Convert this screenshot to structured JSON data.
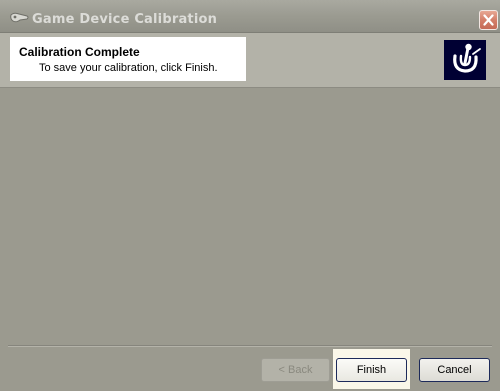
{
  "window": {
    "title": "Game Device Calibration",
    "app_icon": "game-controller-icon",
    "close_icon": "close-icon"
  },
  "header": {
    "title": "Calibration Complete",
    "subtitle": "To save your calibration, click Finish.",
    "logo_icon": "joystick-logo-icon"
  },
  "buttons": {
    "back_label": "< Back",
    "back_enabled": false,
    "finish_label": "Finish",
    "cancel_label": "Cancel"
  },
  "colors": {
    "body_background": "#9b9a8f",
    "close_button": "#d47f6a",
    "logo_background": "#000033",
    "finish_highlight": "#faf7e9"
  }
}
